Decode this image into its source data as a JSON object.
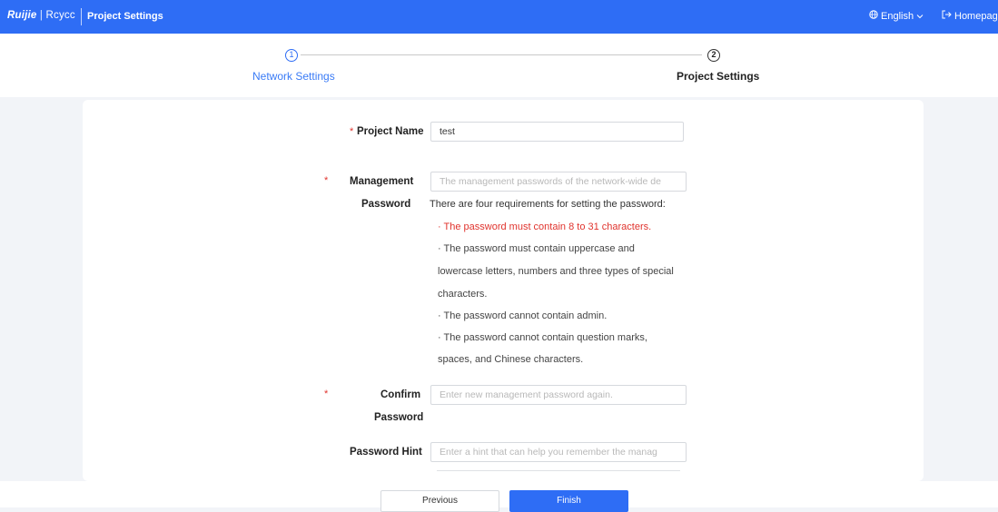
{
  "header": {
    "logo_brand": "Ruijie",
    "logo_sep": " | ",
    "logo_product": "Rcycc",
    "title": "Project Settings",
    "language": "English",
    "homepage": "Homepage"
  },
  "steps": [
    {
      "number": "1",
      "label": "Network Settings",
      "state": "completed"
    },
    {
      "number": "2",
      "label": "Project Settings",
      "state": "active"
    }
  ],
  "form": {
    "project_name": {
      "label": "Project Name",
      "value": "test",
      "required_mark": "*"
    },
    "management_password": {
      "label_line1": "Management",
      "label_line2": "Password",
      "required_mark": "*",
      "placeholder": "The management passwords of the network-wide de",
      "requirements_title": "There are four requirements for setting the password:",
      "requirements": [
        "· The password must contain 8 to 31 characters.",
        "· The password must contain uppercase and",
        "lowercase letters, numbers and three types of special",
        "characters.",
        "· The password cannot contain admin.",
        "· The password cannot contain question marks,",
        "spaces, and Chinese characters."
      ]
    },
    "confirm_password": {
      "label_line1": "Confirm",
      "label_line2": "Password",
      "required_mark": "*",
      "placeholder": "Enter new management password again."
    },
    "password_hint": {
      "label": "Password Hint",
      "placeholder": "Enter a hint that can help you remember the manag"
    }
  },
  "footer": {
    "previous_label": "Previous",
    "finish_label": "Finish"
  },
  "colors": {
    "primary": "#2e6df5",
    "error": "#e0332d",
    "background": "#f2f4f8"
  }
}
